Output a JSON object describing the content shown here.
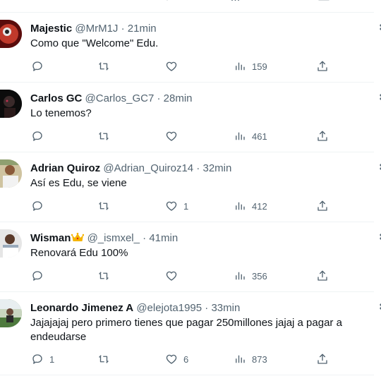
{
  "tweets": [
    {
      "name": "Majestic",
      "handle": "@MrM1J",
      "time": "21min",
      "text": "Como que \"Welcome\" Edu.",
      "replies": "",
      "likes": "",
      "views": "159"
    },
    {
      "name": "Carlos GC",
      "handle": "@Carlos_GC7",
      "time": "28min",
      "text": "Lo tenemos?",
      "replies": "",
      "likes": "",
      "views": "461"
    },
    {
      "name": "Adrian Quiroz",
      "handle": "@Adrian_Quiroz14",
      "time": "32min",
      "text": "Así es Edu, se viene",
      "replies": "",
      "likes": "1",
      "views": "412"
    },
    {
      "name": "Wisman",
      "handle": "@_ismxel_",
      "time": "41min",
      "text": "Renovará Edu 100%",
      "replies": "",
      "likes": "",
      "views": "356"
    },
    {
      "name": "Leonardo Jimenez A",
      "handle": "@elejota1995",
      "time": "33min",
      "text": "Jajajajaj pero primero tienes que pagar 250millones jajaj a pagar a endeudarse",
      "replies": "1",
      "likes": "6",
      "views": "873"
    }
  ],
  "separator": " · ",
  "colors": {
    "text": "#0f1419",
    "muted": "#536471",
    "border": "#eff3f4"
  }
}
